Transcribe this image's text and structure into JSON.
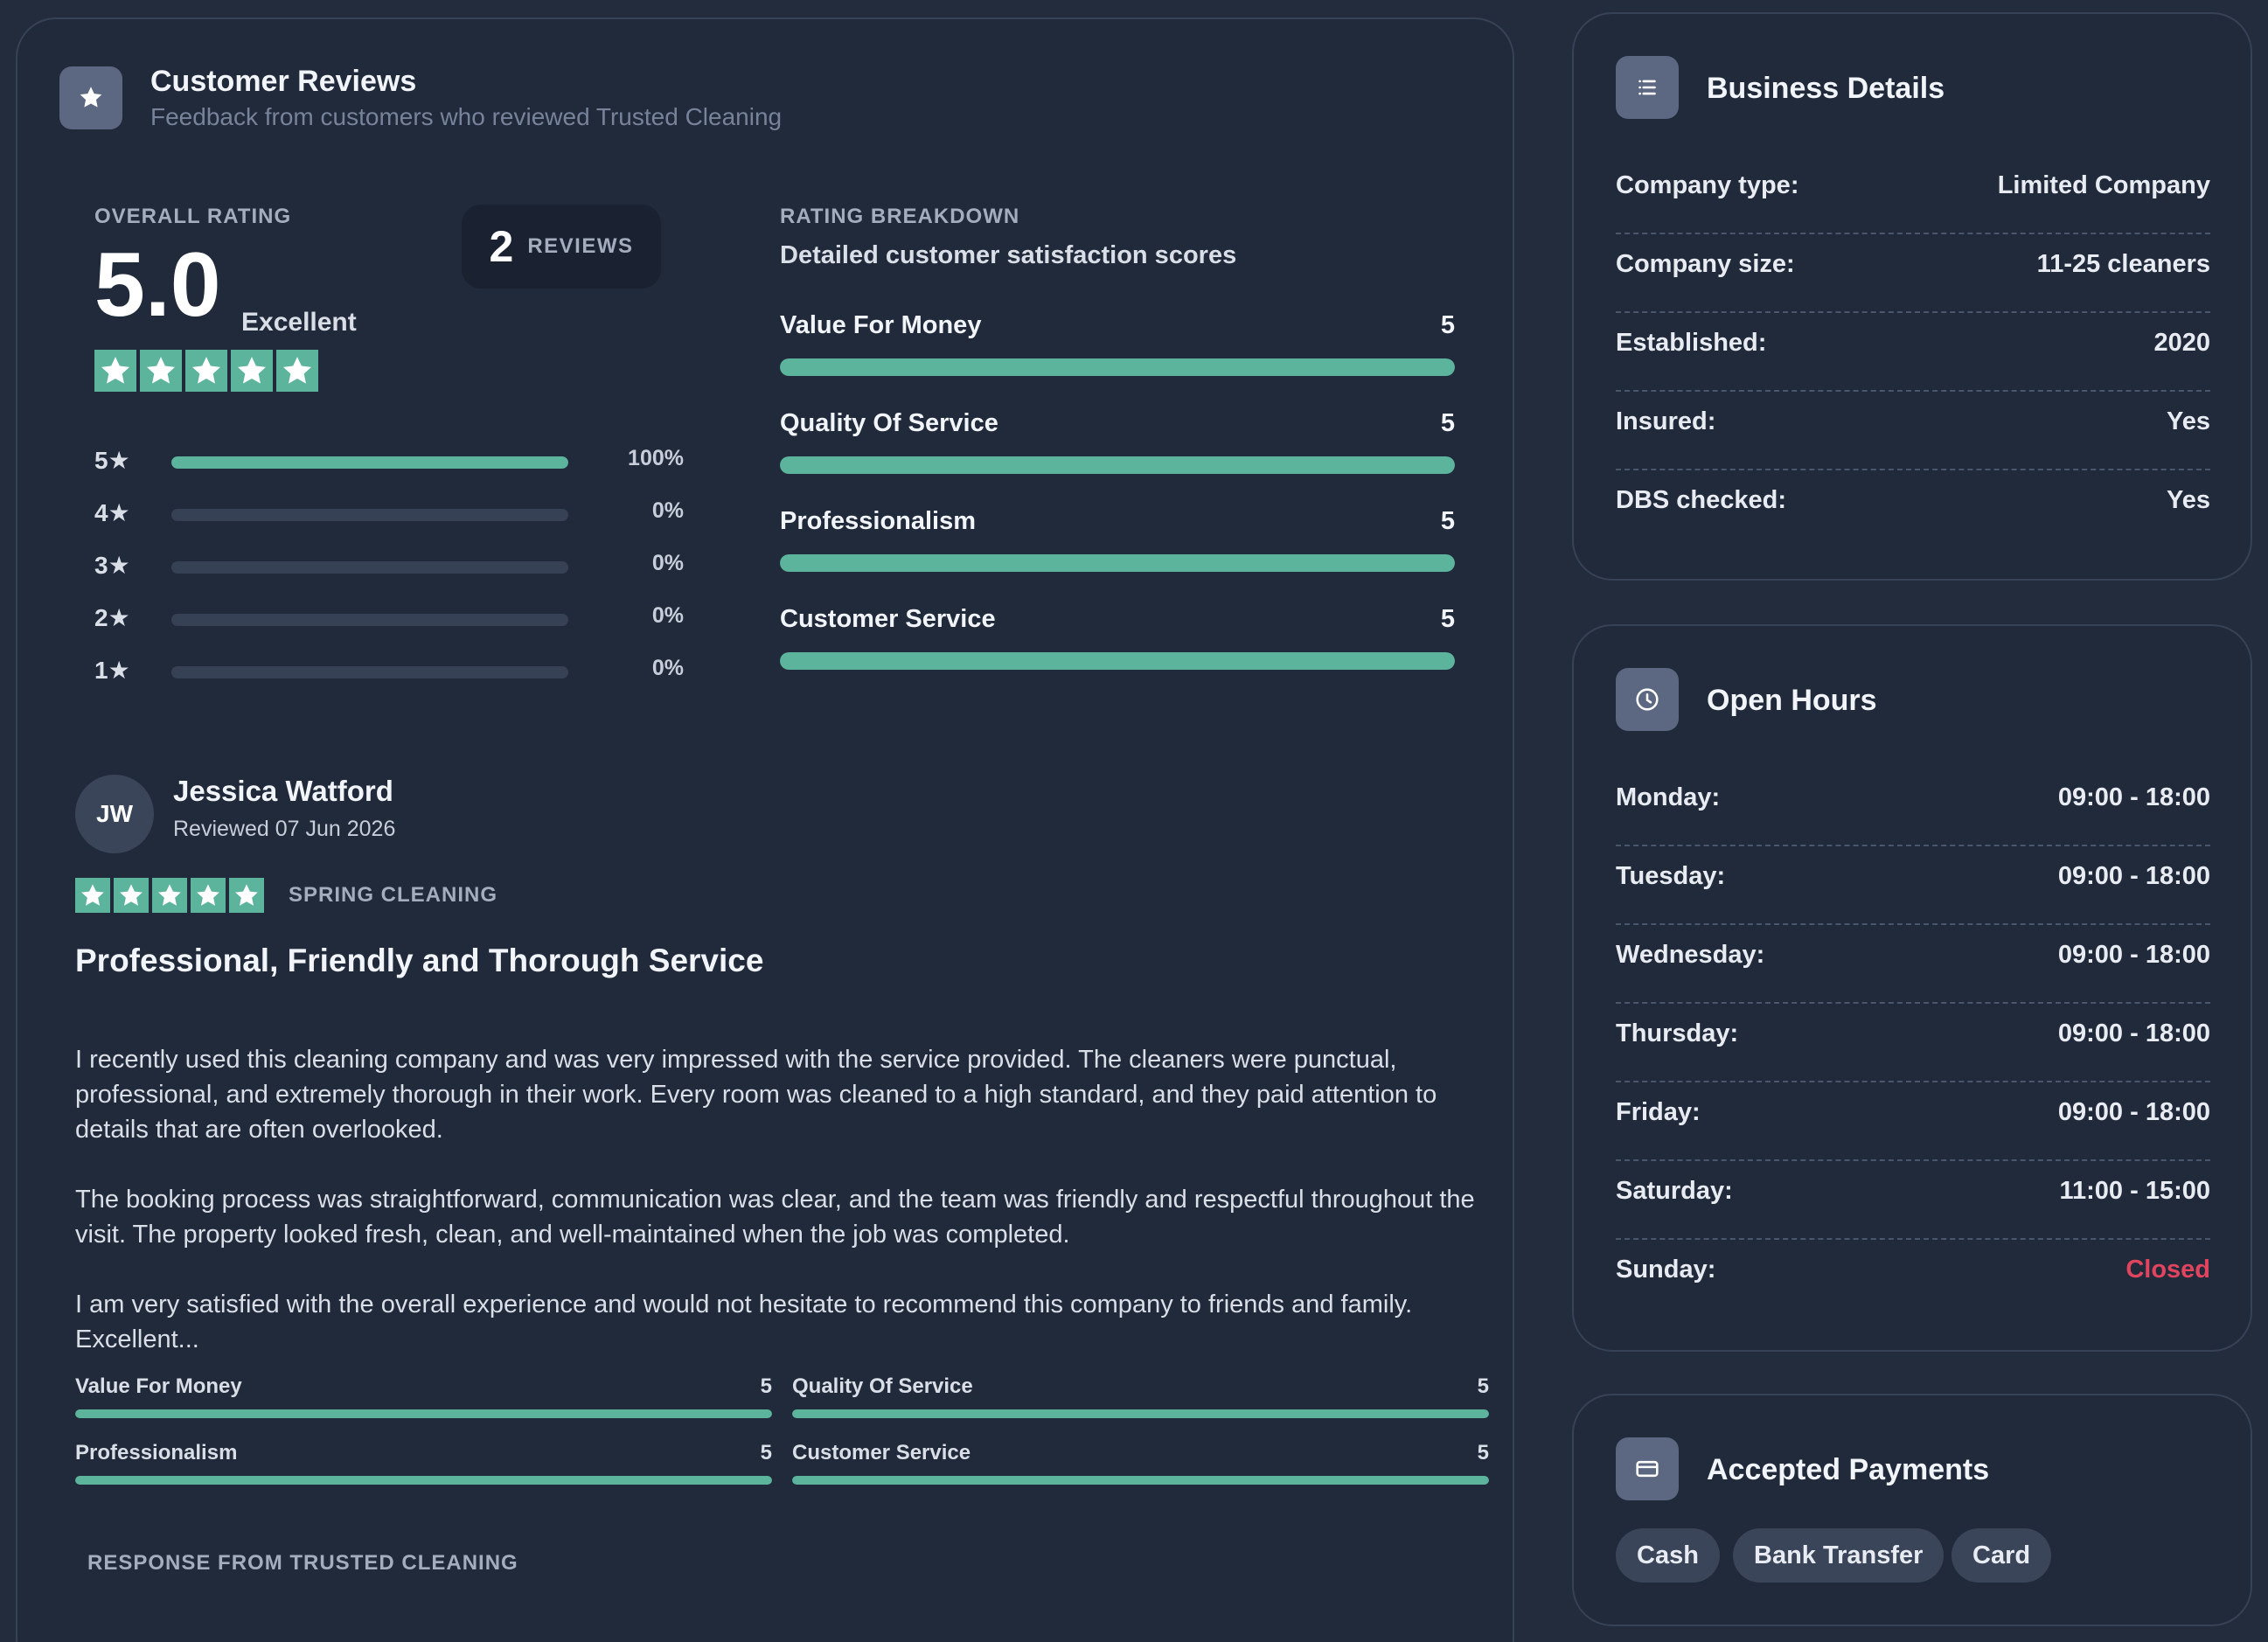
{
  "reviews": {
    "title": "Customer Reviews",
    "subtitle": "Feedback from customers who reviewed Trusted Cleaning",
    "overall_label": "OVERALL RATING",
    "overall_score": "5.0",
    "overall_word": "Excellent",
    "overall_stars": 5,
    "count": "2",
    "count_label": "REVIEWS",
    "distribution": [
      {
        "label": "5★",
        "pct": "100%",
        "fraction": 1.0
      },
      {
        "label": "4★",
        "pct": "0%",
        "fraction": 0.0
      },
      {
        "label": "3★",
        "pct": "0%",
        "fraction": 0.0
      },
      {
        "label": "2★",
        "pct": "0%",
        "fraction": 0.0
      },
      {
        "label": "1★",
        "pct": "0%",
        "fraction": 0.0
      }
    ],
    "breakdown_label": "RATING BREAKDOWN",
    "breakdown_sub": "Detailed customer satisfaction scores",
    "breakdown": [
      {
        "name": "Value For Money",
        "value": "5",
        "fraction": 1.0
      },
      {
        "name": "Quality Of Service",
        "value": "5",
        "fraction": 1.0
      },
      {
        "name": "Professionalism",
        "value": "5",
        "fraction": 1.0
      },
      {
        "name": "Customer Service",
        "value": "5",
        "fraction": 1.0
      }
    ]
  },
  "review": {
    "initials": "JW",
    "name": "Jessica Watford",
    "date": "Reviewed 07 Jun 2026",
    "stars": 5,
    "service": "SPRING CLEANING",
    "title": "Professional, Friendly and Thorough Service",
    "paragraphs": [
      "I recently used this cleaning company and was very impressed with the service provided. The cleaners were punctual, professional, and extremely thorough in their work. Every room was cleaned to a high standard, and they paid attention to details that are often overlooked.",
      "The booking process was straightforward, communication was clear, and the team was friendly and respectful throughout the visit. The property looked fresh, clean, and well-maintained when the job was completed.",
      "I am very satisfied with the overall experience and would not hesitate to recommend this company to friends and family. Excellent..."
    ],
    "scores": [
      {
        "name": "Value For Money",
        "value": "5",
        "fraction": 1.0
      },
      {
        "name": "Quality Of Service",
        "value": "5",
        "fraction": 1.0
      },
      {
        "name": "Professionalism",
        "value": "5",
        "fraction": 1.0
      },
      {
        "name": "Customer Service",
        "value": "5",
        "fraction": 1.0
      }
    ],
    "response_label": "RESPONSE FROM TRUSTED CLEANING"
  },
  "business": {
    "title": "Business Details",
    "rows": [
      {
        "k": "Company type:",
        "v": "Limited Company"
      },
      {
        "k": "Company size:",
        "v": "11-25 cleaners"
      },
      {
        "k": "Established:",
        "v": "2020"
      },
      {
        "k": "Insured:",
        "v": "Yes"
      },
      {
        "k": "DBS checked:",
        "v": "Yes"
      }
    ]
  },
  "hours": {
    "title": "Open Hours",
    "rows": [
      {
        "k": "Monday:",
        "v": "09:00 - 18:00"
      },
      {
        "k": "Tuesday:",
        "v": "09:00 - 18:00"
      },
      {
        "k": "Wednesday:",
        "v": "09:00 - 18:00"
      },
      {
        "k": "Thursday:",
        "v": "09:00 - 18:00"
      },
      {
        "k": "Friday:",
        "v": "09:00 - 18:00"
      },
      {
        "k": "Saturday:",
        "v": "11:00 - 15:00"
      },
      {
        "k": "Sunday:",
        "v": "Closed"
      }
    ]
  },
  "payments": {
    "title": "Accepted Payments",
    "methods": [
      "Cash",
      "Bank Transfer",
      "Card"
    ]
  },
  "colors": {
    "accent": "#5bb49b",
    "closed": "#e0445e",
    "background": "#232c3d"
  }
}
